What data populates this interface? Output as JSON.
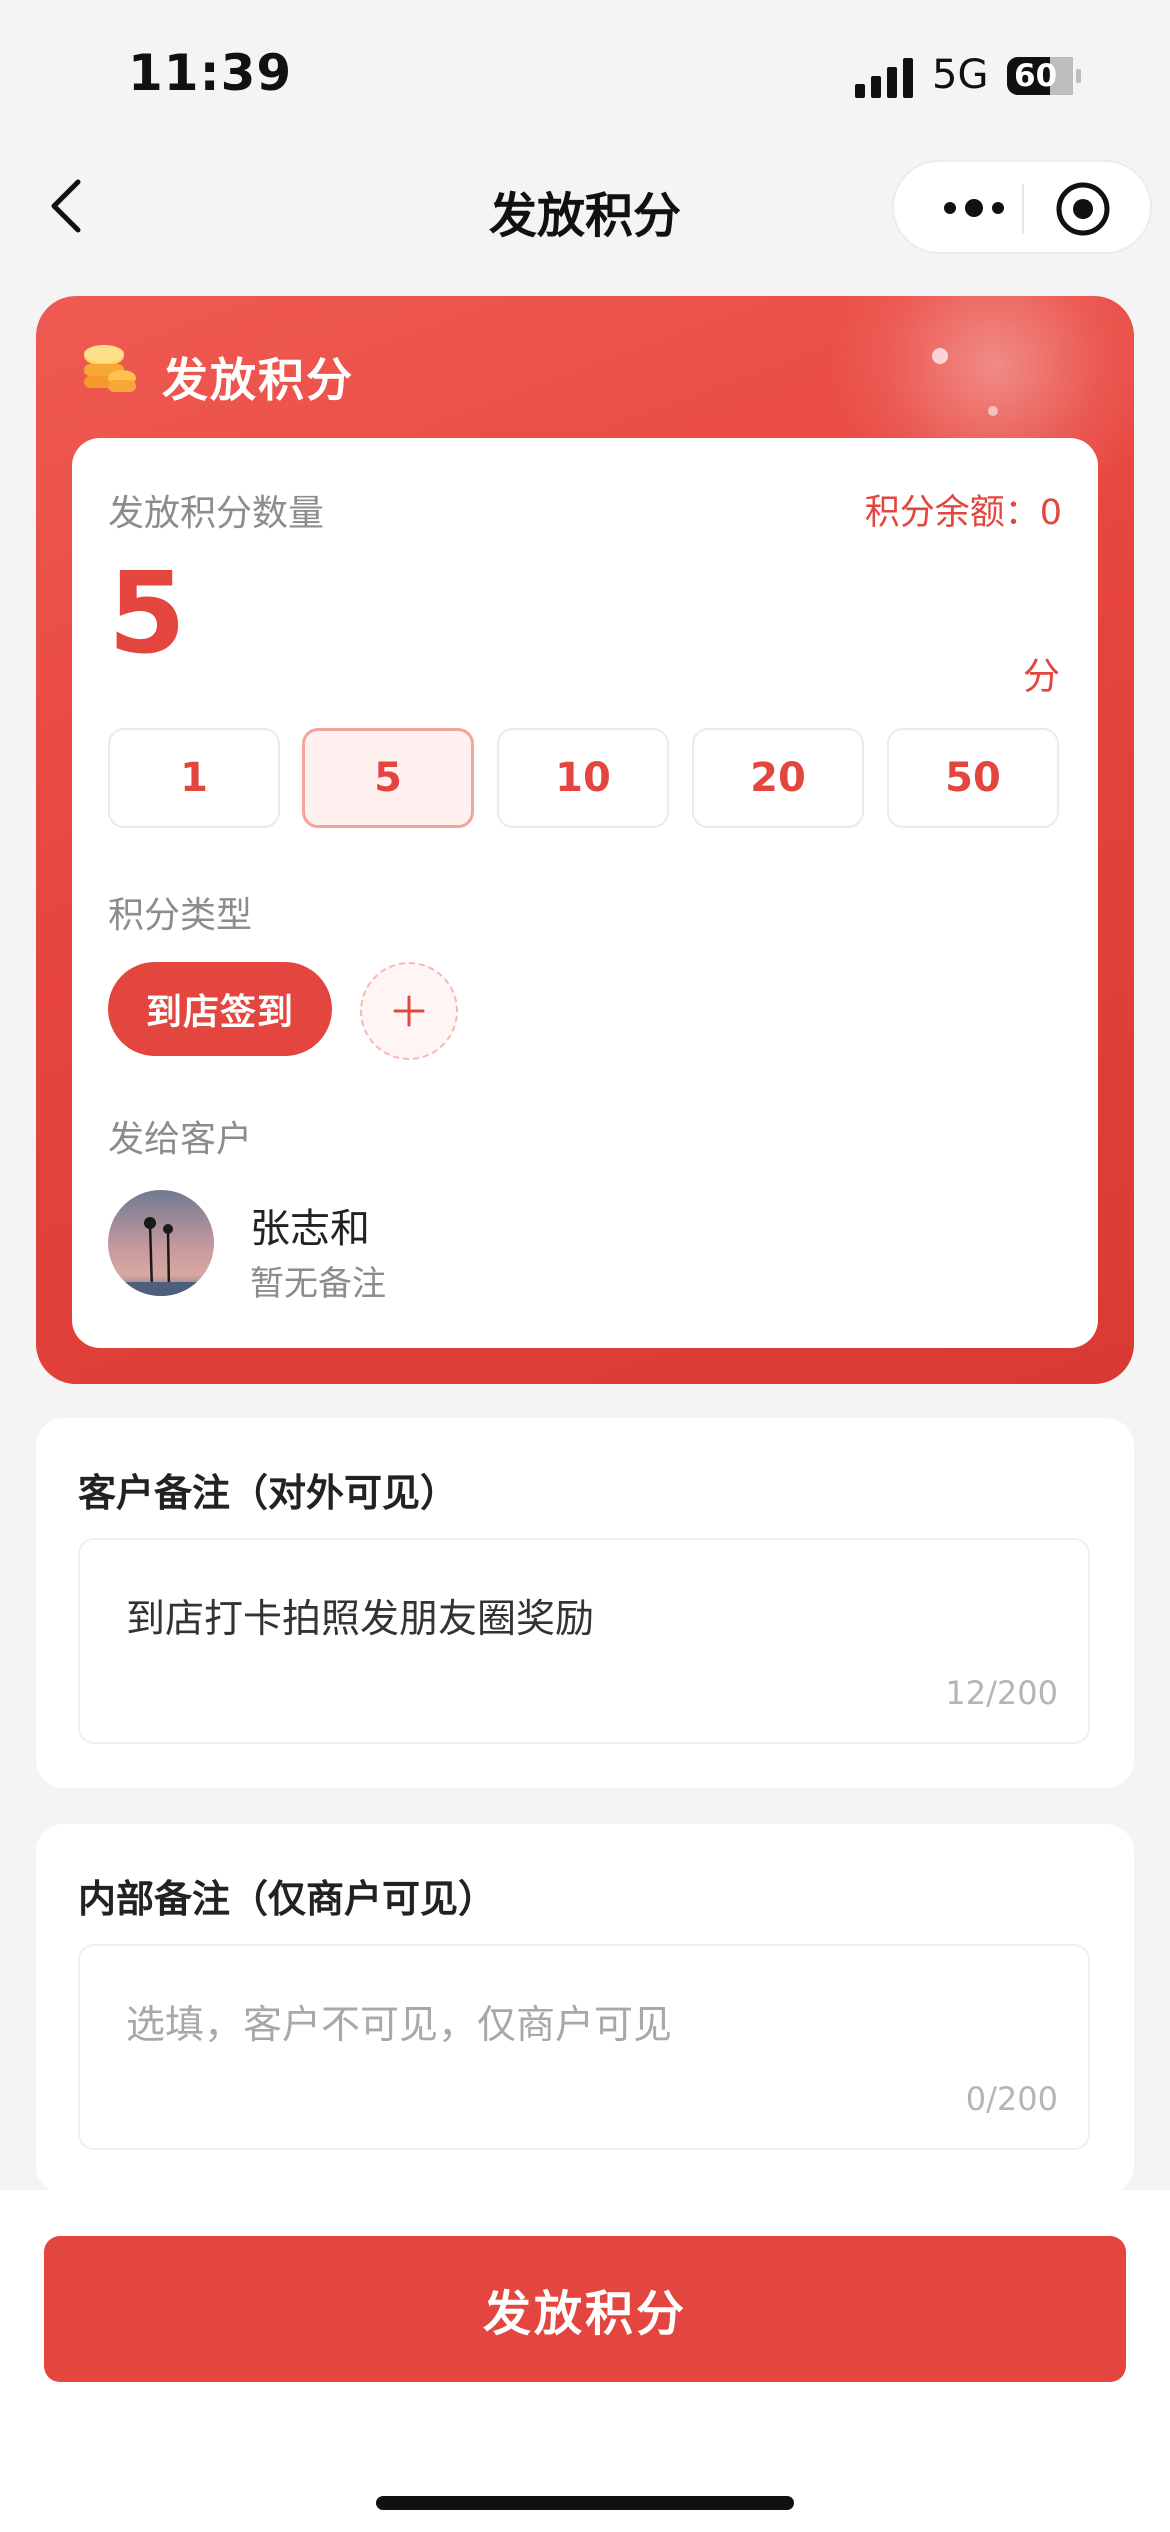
{
  "status_bar": {
    "time": "11:39",
    "network": "5G",
    "battery": "60"
  },
  "nav": {
    "title": "发放积分"
  },
  "card": {
    "title": "发放积分",
    "quantity_label": "发放积分数量",
    "balance_text": "积分余额：0",
    "amount": "5",
    "unit": "分",
    "options": [
      "1",
      "5",
      "10",
      "20",
      "50"
    ],
    "selected_option": "5",
    "type_label": "积分类型",
    "type_selected": "到店签到",
    "customer_label": "发给客户",
    "customer": {
      "name": "张志和",
      "note": "暂无备注"
    }
  },
  "customer_remark": {
    "title": "客户备注（对外可见）",
    "value": "到店打卡拍照发朋友圈奖励",
    "counter": "12/200"
  },
  "internal_remark": {
    "title": "内部备注（仅商户可见）",
    "placeholder": "选填，客户不可见，仅商户可见",
    "counter": "0/200"
  },
  "submit": {
    "label": "发放积分"
  },
  "colors": {
    "accent": "#e2463e",
    "background": "#f4f4f4"
  }
}
